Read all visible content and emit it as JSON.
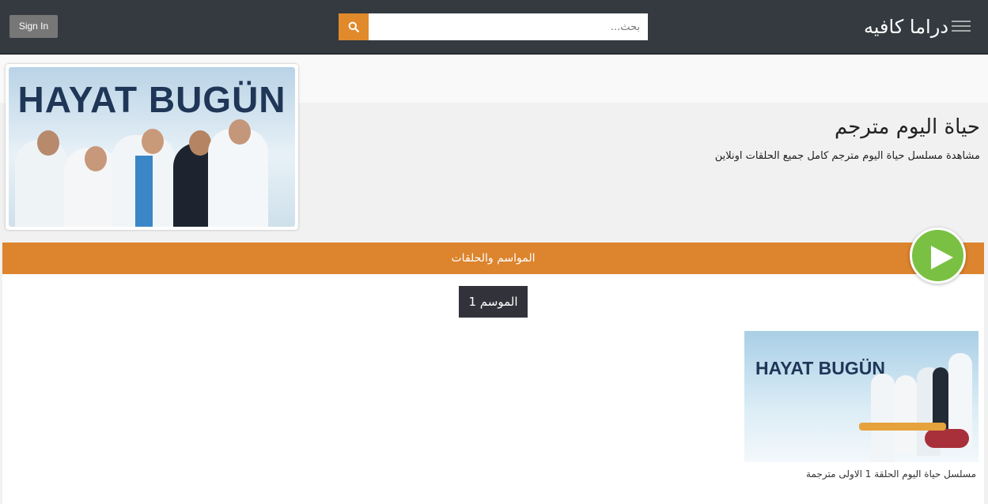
{
  "header": {
    "signin_label": "Sign In",
    "search_placeholder": "بحث...",
    "brand": "دراما كافيه"
  },
  "show": {
    "poster_text": "HAYAT BUGÜN",
    "title": "حياة اليوم مترجم",
    "description": "مشاهدة مسلسل حياة اليوم مترجم كامل جميع الحلقات اونلاين"
  },
  "seasons": {
    "header": "المواسم والحلقات",
    "tabs": [
      "الموسم 1"
    ]
  },
  "episodes": [
    {
      "thumb_text": "HAYAT BUGÜN",
      "title": "مسلسل حياة اليوم الحلقة 1 الاولى مترجمة"
    }
  ],
  "colors": {
    "accent": "#dc842e",
    "topbar": "#343a40",
    "play": "#7ac143"
  }
}
